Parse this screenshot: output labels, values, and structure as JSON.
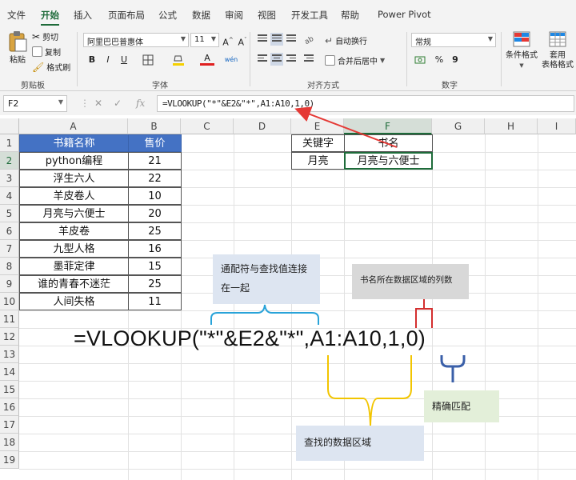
{
  "menu": {
    "tabs": [
      "文件",
      "开始",
      "插入",
      "页面布局",
      "公式",
      "数据",
      "审阅",
      "视图",
      "开发工具",
      "帮助",
      "Power Pivot"
    ],
    "active": "开始"
  },
  "ribbon": {
    "paste": "粘贴",
    "cut": "剪切",
    "copy": "复制",
    "format_painter": "格式刷",
    "clipboard_label": "剪贴板",
    "font_name": "阿里巴巴普惠体",
    "font_size": "11",
    "font_label": "字体",
    "bold": "B",
    "italic": "I",
    "underline": "U",
    "wrap_text": "自动换行",
    "merge_center": "合并后居中",
    "align_label": "对齐方式",
    "number_format": "常规",
    "number_label": "数字",
    "percent": "%",
    "comma": "9",
    "cond_format": "条件格式",
    "table_format_1": "套用",
    "table_format_2": "表格格式"
  },
  "formula_bar": {
    "name_box": "F2",
    "fx": "fx",
    "formula": "=VLOOKUP(\"*\"&E2&\"*\",A1:A10,1,0)"
  },
  "grid": {
    "columns": [
      "A",
      "B",
      "C",
      "D",
      "E",
      "F",
      "G",
      "H",
      "I"
    ],
    "rows": [
      "1",
      "2",
      "3",
      "4",
      "5",
      "6",
      "7",
      "8",
      "9",
      "10",
      "11",
      "12",
      "13",
      "14",
      "15",
      "16",
      "17",
      "18",
      "19"
    ],
    "selected_column": "F",
    "selected_row": "2"
  },
  "table": {
    "headers": [
      "书籍名称",
      "售价"
    ],
    "rows": [
      [
        "python编程",
        "21"
      ],
      [
        "浮生六人",
        "22"
      ],
      [
        "羊皮卷人",
        "10"
      ],
      [
        "月亮与六便士",
        "20"
      ],
      [
        "羊皮卷",
        "25"
      ],
      [
        "九型人格",
        "16"
      ],
      [
        "墨菲定律",
        "15"
      ],
      [
        "谁的青春不迷茫",
        "25"
      ],
      [
        "人间失格",
        "11"
      ]
    ]
  },
  "lookup": {
    "key_label": "关键字",
    "result_label": "书名",
    "key_value": "月亮",
    "result_value": "月亮与六便士"
  },
  "annotation": {
    "big_formula": "=VLOOKUP(\"*\"&E2&\"*\",A1:A10,1,0)",
    "note_wildcard": "通配符与查找值连接在一起",
    "note_column": "书名所在数据区域的列数",
    "note_exact": "精确匹配",
    "note_range": "查找的数据区域"
  },
  "colors": {
    "table_header": "#4472c4",
    "accent_green": "#1e6b3a",
    "arrow_red": "#e53935",
    "brace_blue": "#29a3d9",
    "brace_yellow": "#f2c500",
    "brace_red": "#d32f2f",
    "brace_navy": "#3a5fa8"
  }
}
